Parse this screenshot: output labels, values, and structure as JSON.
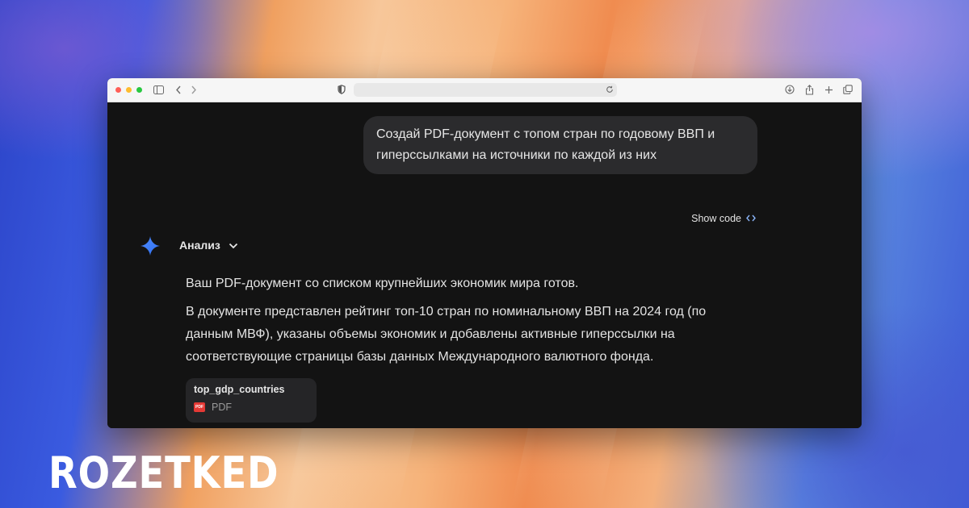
{
  "user_message": {
    "line1": "Создай PDF-документ с топом стран по годовому ВВП и",
    "line2": "гиперссылками на источники по каждой из них"
  },
  "show_code_label": "Show code",
  "analysis_label": "Анализ",
  "response": {
    "p1": "Ваш PDF-документ со списком крупнейших экономик мира готов.",
    "p2_line1": "В документе представлен рейтинг топ-10 стран по номинальному ВВП на 2024 год (по",
    "p2_line2": "данным МВФ), указаны объемы экономик и добавлены активные гиперссылки на",
    "p2_line3": "соответствующие страницы базы данных Международного валютного фонда."
  },
  "file": {
    "name": "top_gdp_countries",
    "type": "PDF",
    "badge": "PDF"
  },
  "watermark": "ROZETKED",
  "icons": {
    "sidebar": "sidebar-icon",
    "back": "chevron-left-icon",
    "forward": "chevron-right-icon",
    "privacy": "shield-icon",
    "reload": "reload-icon",
    "download": "download-icon",
    "share": "share-icon",
    "new_tab": "plus-icon",
    "tabs": "tabs-overview-icon",
    "gemini": "sparkle-icon",
    "expand": "chevron-down-icon",
    "code": "code-brackets-icon"
  },
  "colors": {
    "accent_blue": "#8ab4f8",
    "pdf_red": "#e53935"
  }
}
